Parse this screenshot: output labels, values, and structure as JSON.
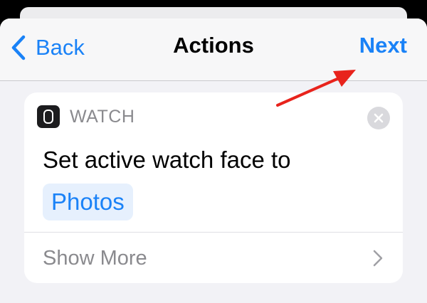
{
  "nav": {
    "back_label": "Back",
    "title": "Actions",
    "next_label": "Next"
  },
  "action_card": {
    "app_name": "WATCH",
    "app_icon": "watch-icon",
    "action_text": "Set active watch face to",
    "parameter_value": "Photos",
    "show_more_label": "Show More"
  },
  "colors": {
    "accent": "#1a82f7",
    "annotation_arrow": "#e8231c",
    "sheet_background": "#f2f2f6",
    "card_background": "#ffffff",
    "secondary_text": "#8a8a8e"
  }
}
